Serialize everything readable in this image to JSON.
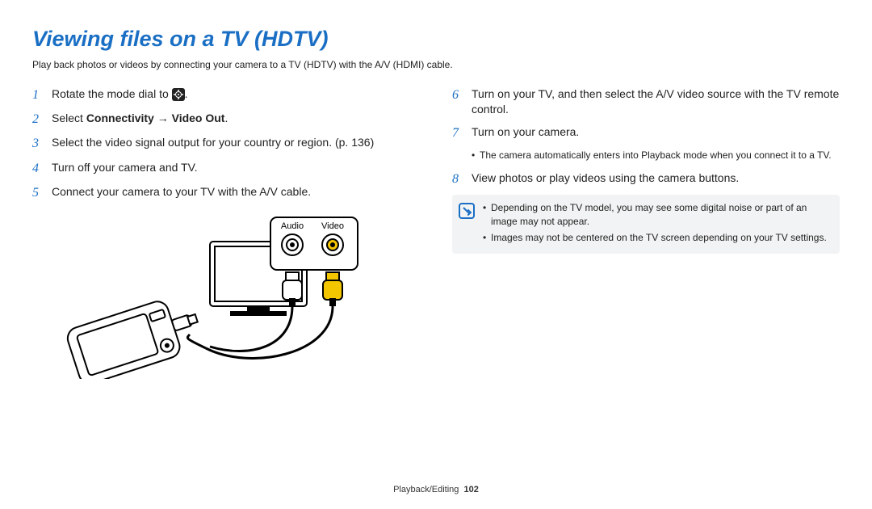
{
  "title": "Viewing files on a TV (HDTV)",
  "intro": "Play back photos or videos by connecting your camera to a TV (HDTV) with the A/V (HDMI) cable.",
  "left_steps": {
    "s1": {
      "num": "1",
      "text_before": "Rotate the mode dial to ",
      "text_after": "."
    },
    "s2": {
      "num": "2",
      "prefix": "Select ",
      "bold": "Connectivity → Video Out",
      "suffix": "."
    },
    "s3": {
      "num": "3",
      "text": "Select the video signal output for your country or region. (p. 136)"
    },
    "s4": {
      "num": "4",
      "text": "Turn off your camera and TV."
    },
    "s5": {
      "num": "5",
      "text": "Connect your camera to your TV with the A/V cable."
    }
  },
  "diagram": {
    "audio_label": "Audio",
    "video_label": "Video"
  },
  "right_steps": {
    "s6": {
      "num": "6",
      "text": "Turn on your TV, and then select the A/V video source with the TV remote control."
    },
    "s7": {
      "num": "7",
      "text": "Turn on your camera."
    },
    "s7_sub": "The camera automatically enters into Playback mode when you connect it to a TV.",
    "s8": {
      "num": "8",
      "text": "View photos or play videos using the camera buttons."
    }
  },
  "note": {
    "n1": "Depending on the TV model, you may see some digital noise or part of an image may not appear.",
    "n2": "Images may not be centered on the TV screen depending on your TV settings."
  },
  "footer": {
    "section": "Playback/Editing",
    "page": "102"
  }
}
